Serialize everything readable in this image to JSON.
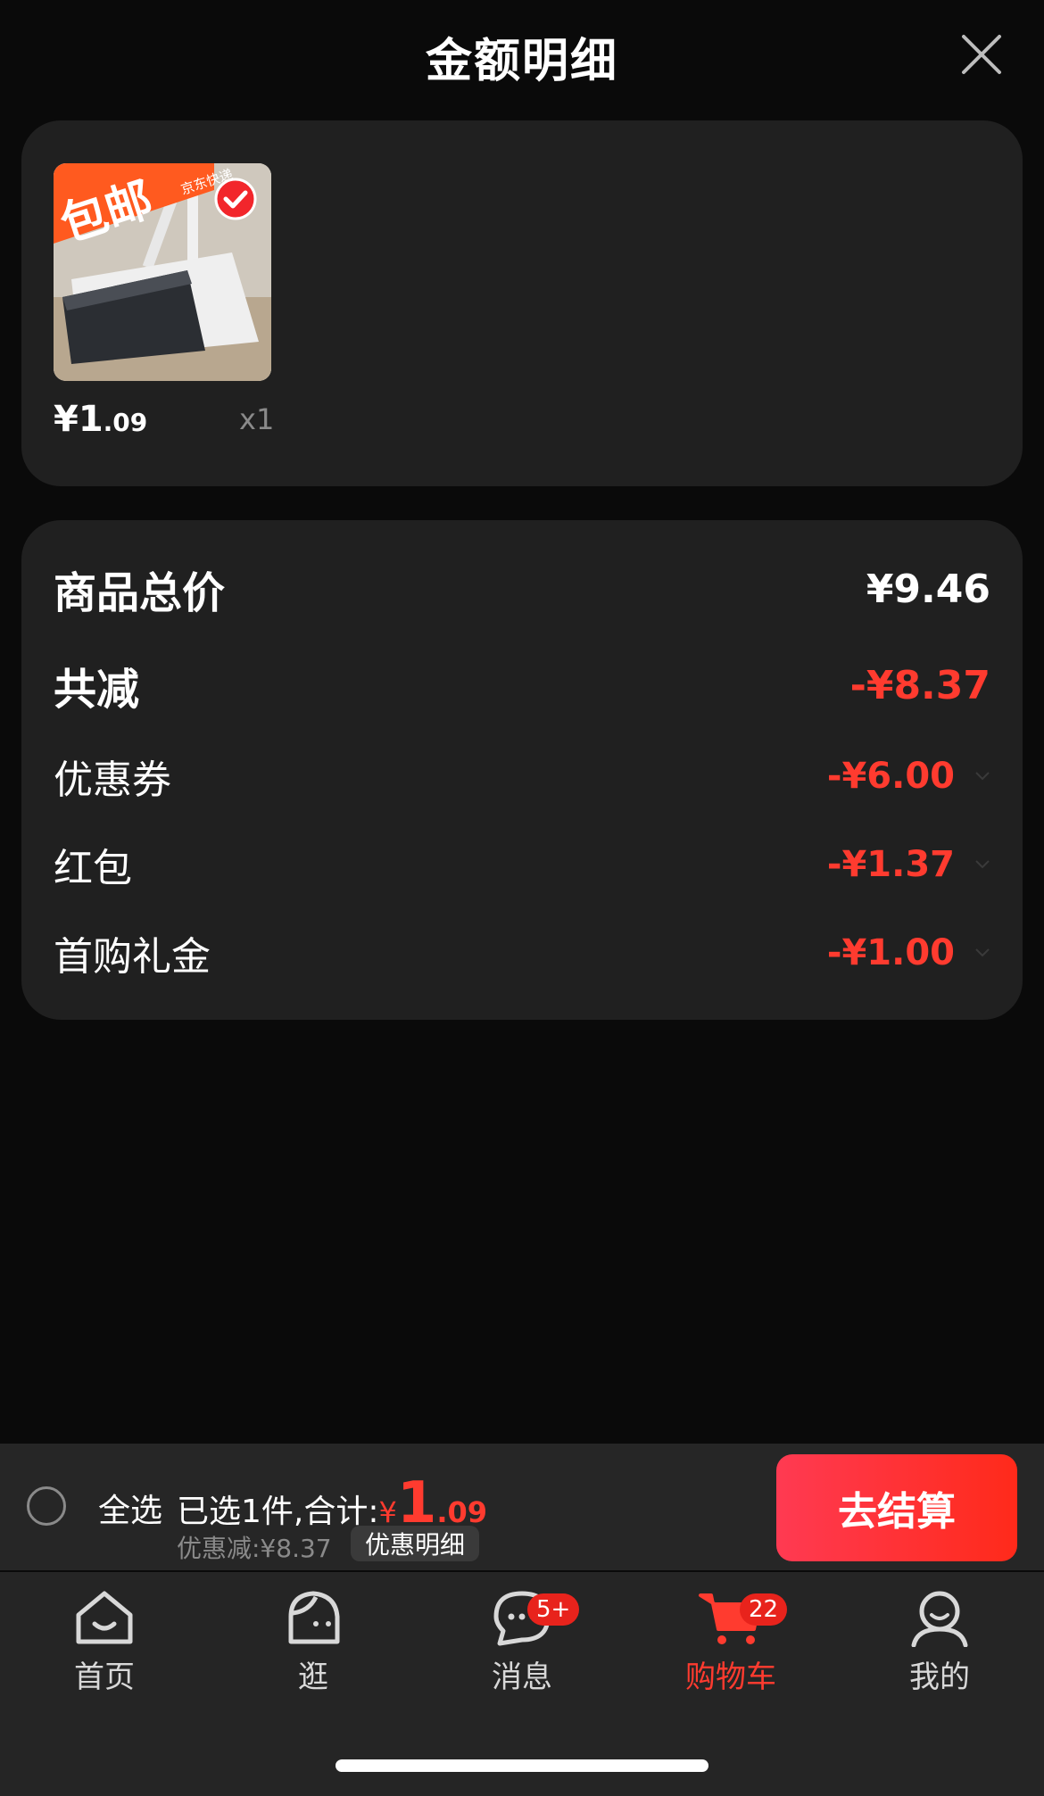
{
  "header": {
    "title": "金额明细"
  },
  "product": {
    "image_banner": "包邮",
    "image_badge": "京东快递",
    "price_main": "¥1",
    "price_decimal": ".09",
    "quantity": "x1"
  },
  "totals": {
    "goods_total_label": "商品总价",
    "goods_total_value": "¥9.46",
    "total_reduction_label": "共减",
    "total_reduction_value": "-¥8.37",
    "items": [
      {
        "label": "优惠券",
        "value": "-¥6.00"
      },
      {
        "label": "红包",
        "value": "-¥1.37"
      },
      {
        "label": "首购礼金",
        "value": "-¥1.00"
      }
    ]
  },
  "bottom_bar": {
    "select_all": "全选",
    "selected_text": "已选1件,合计:",
    "total_currency": "¥",
    "total_int": "1",
    "total_dec": ".09",
    "discount_text": "优惠减:¥8.37",
    "detail_button": "优惠明细",
    "checkout_button": "去结算"
  },
  "tabbar": {
    "tabs": [
      {
        "label": "首页",
        "icon": "home-icon"
      },
      {
        "label": "逛",
        "icon": "browse-icon"
      },
      {
        "label": "消息",
        "icon": "message-icon",
        "badge": "5+"
      },
      {
        "label": "购物车",
        "icon": "cart-icon",
        "badge": "22",
        "active": true
      },
      {
        "label": "我的",
        "icon": "profile-icon"
      }
    ]
  },
  "colors": {
    "accent_red": "#ff3b2f",
    "background": "#0a0a0a",
    "card": "#202020"
  }
}
